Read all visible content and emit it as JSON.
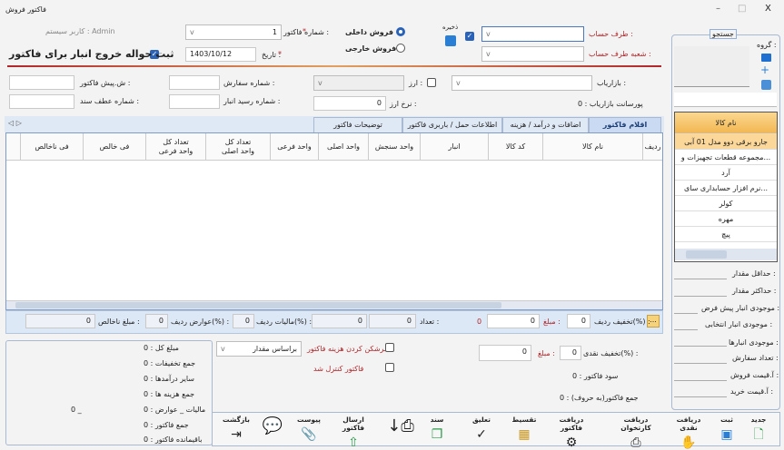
{
  "window": {
    "title": "فاکتور فروش",
    "minimize": "–",
    "maximize": "□",
    "close": "X"
  },
  "header": {
    "system_user": "کاربر سیستم : Admin",
    "invoice_number_label": "شماره فاکتور :",
    "invoice_number": "1",
    "date_label": "تاریخ :",
    "date": "1403/10/12",
    "required_mark": "*",
    "warehouse_checkbox_label": "ثبت حواله خروج انبار برای فاکتور",
    "warehouse_checked": true,
    "sale_domestic": "فروش داخلی",
    "sale_foreign": "فروش خارجی",
    "sale_selected": "domestic",
    "save_label": "ذخیره",
    "save_checked": true,
    "account_label": "طرف حساب :",
    "account_branch_label": "شعبه طرف حساب :",
    "chevron": "v"
  },
  "row1": {
    "marketer_label": "بازاریاب :",
    "currency_label": "ارز :",
    "order_no_label": "شماره سفارش :",
    "pre_invoice_label": "ش.پیش فاکتور :"
  },
  "row2": {
    "commission": "پورسانت بازاریاب : 0",
    "rate_label": "نرخ ارز :",
    "rate": "0",
    "receipt_label": "شماره رسید انبار :",
    "ref_label": "شماره عطف سند :"
  },
  "tabs": [
    {
      "label": "اقلام فاکتور",
      "active": true
    },
    {
      "label": "اضافات و درآمد / هزینه"
    },
    {
      "label": "اطلاعات حمل / باربری فاکتور"
    },
    {
      "label": "توضیحات فاکتور"
    }
  ],
  "tab_nav": "◁ ▷",
  "grid": {
    "columns": [
      "ردیف",
      "نام کالا",
      "کد کالا",
      "انبار",
      "واحد سنجش",
      "واحد اصلی",
      "واحد فرعی",
      "تعداد کل واحد اصلی",
      "تعداد کل واحد فرعی",
      "فی خالص",
      "فی ناخالص"
    ]
  },
  "summary": {
    "more": "...",
    "row_discount_label": "تخفیف ردیف(%) :",
    "row_discount": "0",
    "amount_label": "مبلغ :",
    "amount": "0",
    "amount_red": "0",
    "count_label": "تعداد :",
    "count": "0",
    "count2": "0",
    "tax_label": "مالیات ردیف(%) :",
    "tax": "0",
    "duty_label": "عوارض ردیف(%) :",
    "duty": "0",
    "gross_label": "مبلغ ناخالص :",
    "gross": "0"
  },
  "totals": {
    "items": [
      "مبلغ کل : 0",
      "جمع تخفیفات : 0",
      "سایر درآمدها : 0",
      "جمع هزینه ها : 0",
      "مالیات _ عوارض : 0",
      "جمع فاکتور : 0",
      "باقیمانده فاکتور : 0"
    ],
    "side_value": "0 _"
  },
  "middle": {
    "distribute_label": "سرشکن کردن هزینه فاکتور",
    "distribute_by": "براساس مقدار",
    "controlled_label": "فاکتور کنترل شد",
    "cash_discount_label": "تخفیف نقدی(%) :",
    "cash_discount": "0",
    "cash_amount_label": "مبلغ :",
    "cash_amount": "0",
    "profit": "سود فاکتور : 0",
    "total_words": "جمع فاکتور(به حروف) : 0"
  },
  "toolbar": [
    {
      "label": "جدید",
      "icon": "new-doc-icon"
    },
    {
      "label": "ثبت",
      "icon": "save-icon"
    },
    {
      "label": "دریافت نقدی",
      "icon": "cash-icon"
    },
    {
      "label": "دریافت کارتخوان",
      "icon": "card-reader-icon"
    },
    {
      "label": "دریافت فاکتور",
      "icon": "receive-icon"
    },
    {
      "label": "تقسیط",
      "icon": "abacus-icon"
    },
    {
      "label": "تعلیق",
      "icon": "check-icon"
    },
    {
      "label": "سند",
      "icon": "copy-icon"
    },
    {
      "label": "",
      "icon": "printer-icon"
    },
    {
      "label": "ارسال فاکتور",
      "icon": "send-icon"
    },
    {
      "label": "پیوست",
      "icon": "paperclip-icon"
    },
    {
      "label": "",
      "icon": "chat-icon"
    },
    {
      "label": "بازگشت",
      "icon": "exit-icon"
    }
  ],
  "search": {
    "legend": "جستجو",
    "group_label": "گروه :",
    "list_header": "نام کالا",
    "items": [
      "جارو برقی دوو مدل 01 آبی",
      "مجموعه قطعات تجهیزات و...",
      "آرد",
      "نرم افزار حسابداری سای...",
      "کولر",
      "مهره",
      "پیچ"
    ],
    "selected": 0,
    "fields": [
      "حداقل مقدار :",
      "حداکثر مقدار :",
      "موجودی انبار پیش فرض :",
      "موجودی انبار انتخابی :",
      "موجودی انبارها :",
      "تعداد سفارش :",
      "آ.قیمت فروش :",
      "آ.قیمت خرید :"
    ]
  },
  "colors": {
    "accent": "#2a62b8",
    "required": "#b0262a",
    "list_header": "#f6c46a",
    "panel": "#dde8f6"
  }
}
